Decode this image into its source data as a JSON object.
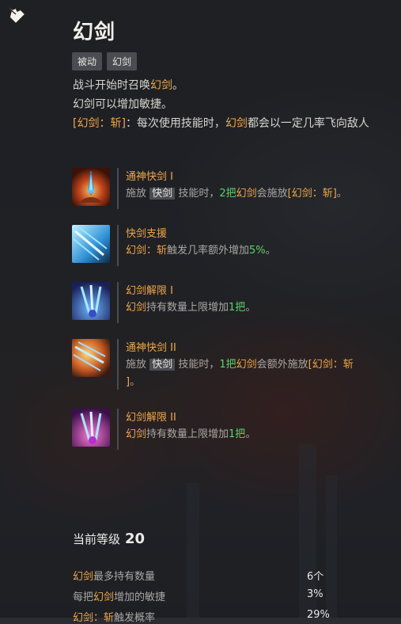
{
  "skill": {
    "title": "幻剑",
    "tags": [
      "被动",
      "幻剑"
    ],
    "desc1": {
      "a": "战斗开始时召唤",
      "b": "幻剑",
      "c": "。"
    },
    "desc2": "幻剑可以增加敏捷。",
    "desc3": {
      "a": "[幻剑：斩]",
      "b": "：每次使用技能时，",
      "c": "幻剑",
      "d": "都会以一定几率飞向敌人"
    }
  },
  "talents": [
    {
      "name": "通神快剑 I",
      "t1": "施放",
      "t2": "快剑",
      "t3": "技能时，",
      "t4": "2把",
      "t5": "幻剑",
      "t6": "会施放",
      "t7": "[幻剑：斩]",
      "t8": "。",
      "icon": "sword-hand-icon"
    },
    {
      "name": "快剑支援",
      "t1": "幻剑：斩",
      "t2": "触发几率额外增加",
      "t3": "5%",
      "t4": "。",
      "icon": "flying-swords-icon"
    },
    {
      "name": "幻剑解限 I",
      "t1": "幻剑",
      "t2": "持有数量上限增加",
      "t3": "1把",
      "t4": "。",
      "icon": "sword-fan-blue-icon"
    },
    {
      "name": "通神快剑 II",
      "t1": "施放",
      "t2": "快剑",
      "t3": "技能时，",
      "t4": "1把",
      "t5": "幻剑",
      "t6": "会额外施放",
      "t7": "[幻剑：斩",
      "t8": "]",
      "t9": "。",
      "icon": "sword-fan-orange-icon"
    },
    {
      "name": "幻剑解限 II",
      "t1": "幻剑",
      "t2": "持有数量上限增加",
      "t3": "1把",
      "t4": "。",
      "icon": "sword-fan-purple-icon"
    }
  ],
  "level": {
    "label": "当前等级",
    "value": "20"
  },
  "stats": [
    {
      "a": "幻剑",
      "b": "最多持有数量",
      "value": "6个"
    },
    {
      "a": "每把",
      "b": "幻剑",
      "c": "增加的敏捷",
      "value": "3%"
    },
    {
      "a": "幻剑：斩",
      "b": "触发概率",
      "value": "29%"
    }
  ],
  "colors": {
    "accent": "#f1a64a",
    "positive": "#5bd46a",
    "text": "#d9d6cf"
  }
}
